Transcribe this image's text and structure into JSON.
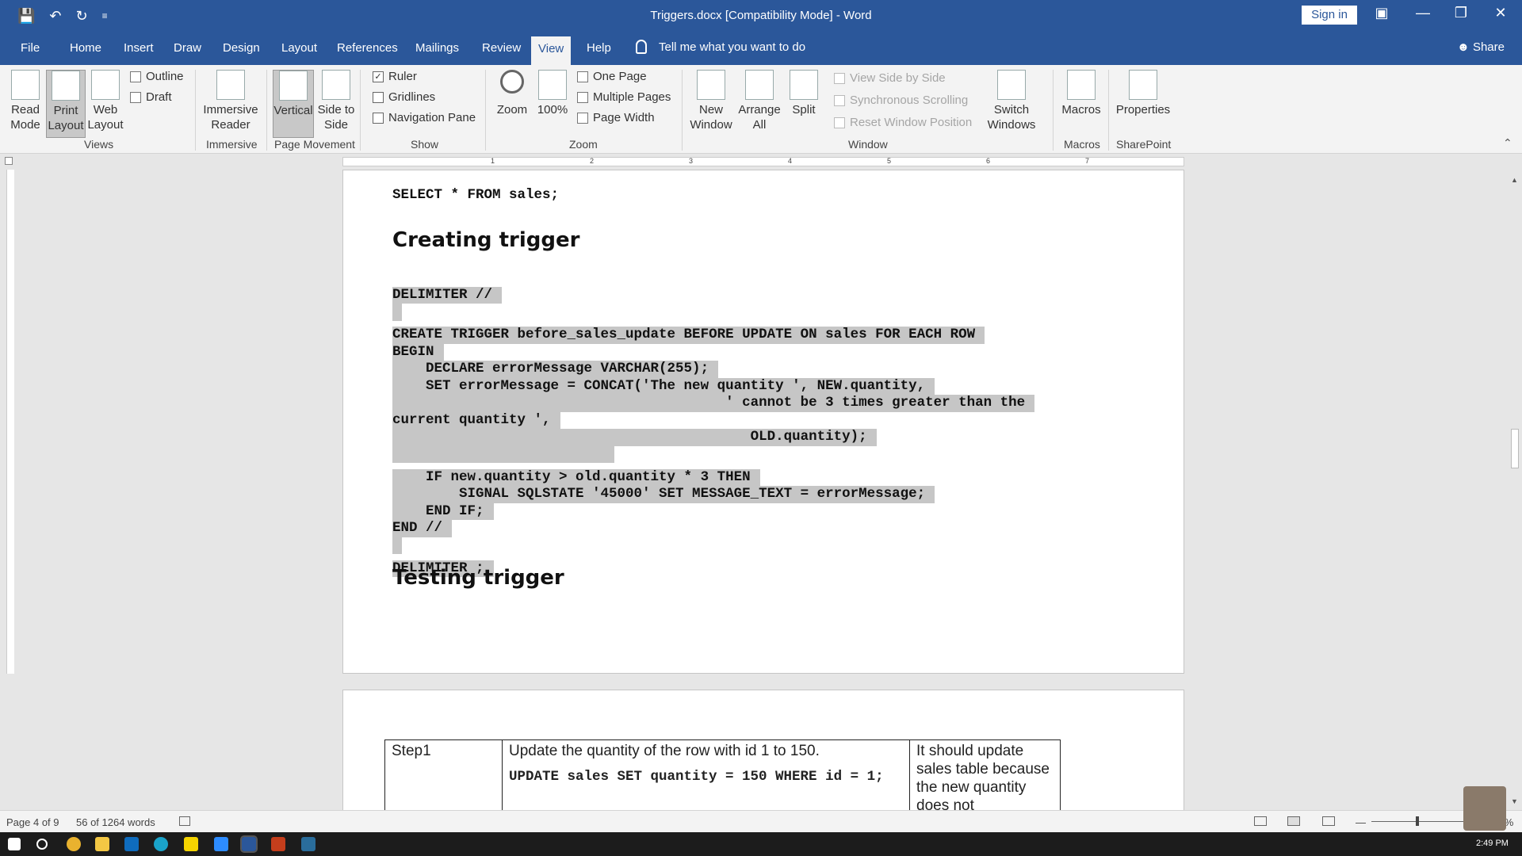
{
  "titlebar": {
    "title": "Triggers.docx [Compatibility Mode]  -  Word",
    "sign_in": "Sign in",
    "save_icon": "💾",
    "undo_icon": "↶",
    "redo_icon": "↻",
    "customize_icon": "≡",
    "display_options_icon": "▣",
    "minimize_icon": "—",
    "restore_icon": "❐",
    "close_icon": "✕"
  },
  "tabs": [
    "File",
    "Home",
    "Insert",
    "Draw",
    "Design",
    "Layout",
    "References",
    "Mailings",
    "Review",
    "View",
    "Help"
  ],
  "tell_me": "Tell me what you want to do",
  "share": "Share",
  "ribbon": {
    "read_mode": "Read Mode",
    "print_layout": "Print Layout",
    "web_layout": "Web Layout",
    "outline": "Outline",
    "draft": "Draft",
    "views_label": "Views",
    "immersive_reader": "Immersive Reader",
    "immersive_label": "Immersive",
    "vertical": "Vertical",
    "side_to_side": "Side to Side",
    "page_movement_label": "Page Movement",
    "ruler": "Ruler",
    "gridlines": "Gridlines",
    "navigation_pane": "Navigation Pane",
    "show_label": "Show",
    "zoom": "Zoom",
    "hundred": "100%",
    "one_page": "One Page",
    "multiple_pages": "Multiple Pages",
    "page_width": "Page Width",
    "zoom_label": "Zoom",
    "new_window": "New Window",
    "arrange_all": "Arrange All",
    "split": "Split",
    "view_side_by_side": "View Side by Side",
    "synchronous_scrolling": "Synchronous Scrolling",
    "reset_window_position": "Reset Window Position",
    "switch_windows": "Switch Windows",
    "window_label": "Window",
    "macros": "Macros",
    "macros_label": "Macros",
    "properties": "Properties",
    "sharepoint_label": "SharePoint",
    "ruler_checked": "✓",
    "collapse_icon": "⌃"
  },
  "document": {
    "line_top": "SELECT * FROM sales;",
    "heading1": "Creating trigger",
    "code_lines": [
      "DELIMITER //",
      "",
      "CREATE TRIGGER before_sales_update BEFORE UPDATE ON sales FOR EACH ROW",
      "BEGIN",
      "    DECLARE errorMessage VARCHAR(255);",
      "    SET errorMessage = CONCAT('The new quantity ', NEW.quantity,",
      "                                        ' cannot be 3 times greater than the",
      "current quantity ',",
      "                                           OLD.quantity);",
      "",
      "    IF new.quantity > old.quantity * 3 THEN",
      "        SIGNAL SQLSTATE '45000' SET MESSAGE_TEXT = errorMessage;",
      "    END IF;",
      "END //",
      "",
      "DELIMITER ;"
    ],
    "heading2": "Testing trigger",
    "table": {
      "step": "Step1",
      "description": "Update the quantity of the row with id 1 to 150.",
      "sql": "UPDATE sales SET quantity = 150 WHERE id = 1;",
      "expected": "It should update sales table because the new quantity does not"
    }
  },
  "ruler_numbers": [
    "1",
    "2",
    "3",
    "4",
    "5",
    "6",
    "7"
  ],
  "status": {
    "page": "Page 4 of 9",
    "words": "56 of 1264 words",
    "zoom": "100%"
  },
  "clock": "2:49 PM"
}
